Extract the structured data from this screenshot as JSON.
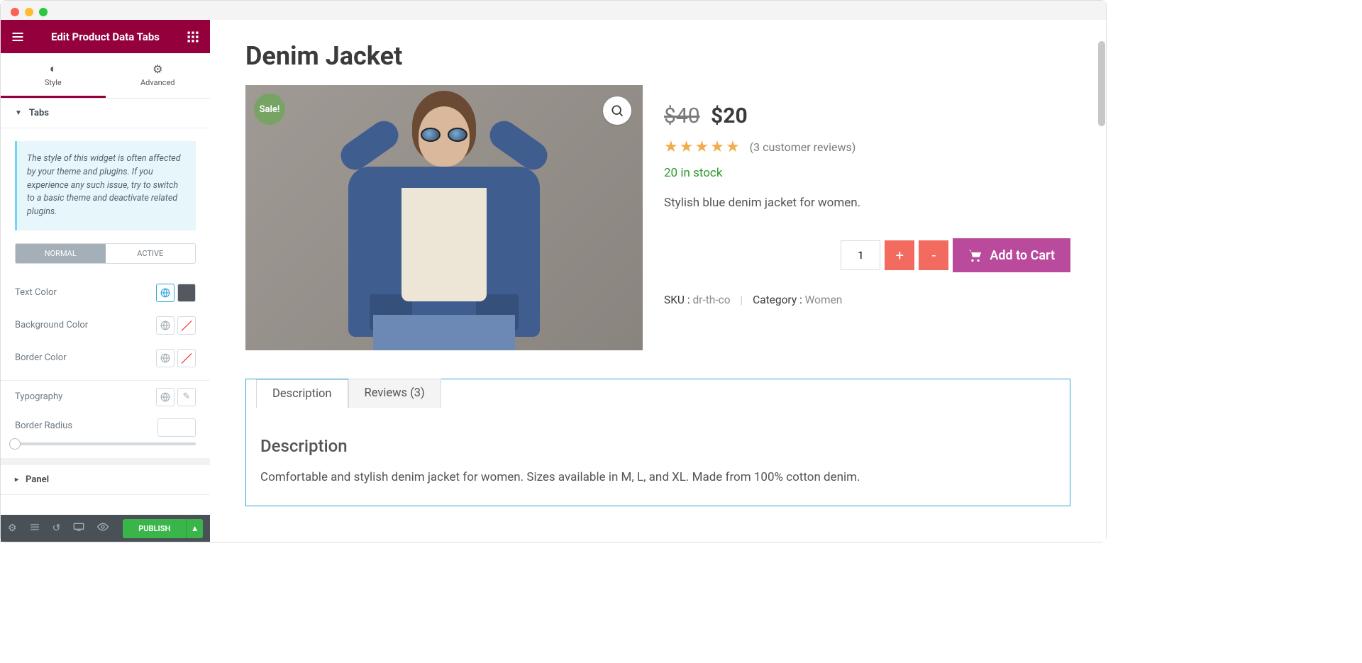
{
  "header": {
    "title": "Edit Product Data Tabs"
  },
  "topTabs": {
    "style": "Style",
    "advanced": "Advanced"
  },
  "sections": {
    "tabs": "Tabs",
    "panel": "Panel"
  },
  "info": "The style of this widget is often affected by your theme and plugins. If you experience any such issue, try to switch to a basic theme and deactivate related plugins.",
  "stateTabs": {
    "normal": "Normal",
    "active": "Active"
  },
  "controls": {
    "textColor": "Text Color",
    "backgroundColor": "Background Color",
    "borderColor": "Border Color",
    "typography": "Typography",
    "borderRadius": "Border Radius"
  },
  "footer": {
    "publish": "Publish"
  },
  "product": {
    "title": "Denim Jacket",
    "sale": "Sale!",
    "priceOld": "$40",
    "priceNew": "$20",
    "reviewsLink": "(3 customer reviews)",
    "stock": "20 in stock",
    "shortDesc": "Stylish blue denim jacket for women.",
    "qty": "1",
    "addToCart": "Add to Cart",
    "skuLabel": "SKU :",
    "sku": "dr-th-co",
    "catLabel": "Category :",
    "category": "Women"
  },
  "dataTabs": {
    "description": "Description",
    "reviews": "Reviews (3)",
    "panelTitle": "Description",
    "panelContent": "Comfortable and stylish denim jacket for women. Sizes available in M, L, and XL. Made from 100% cotton denim."
  }
}
